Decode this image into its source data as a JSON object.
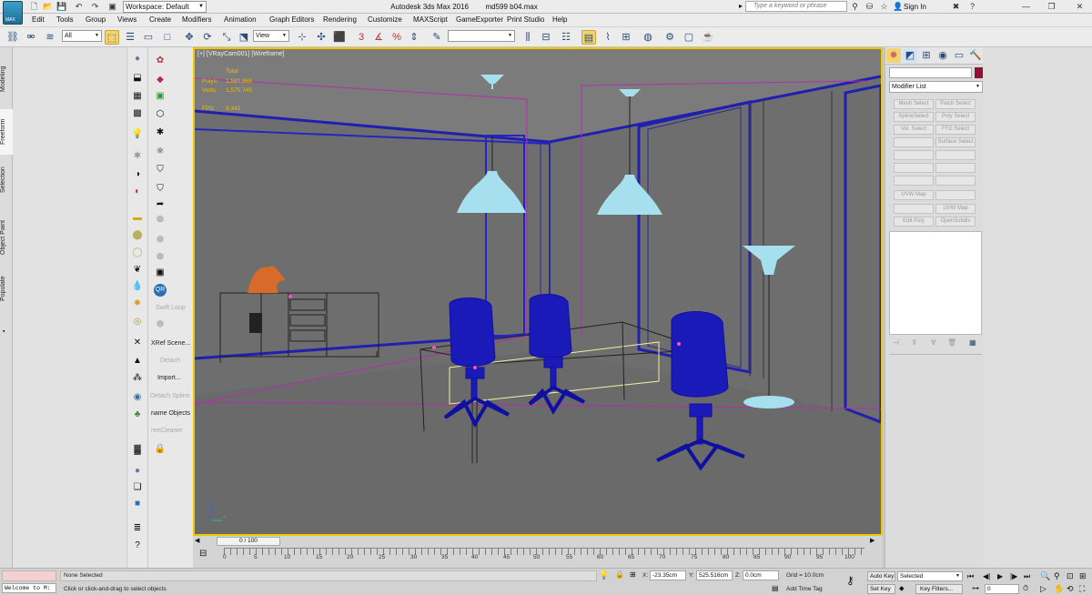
{
  "title_bar": {
    "app_title": "Autodesk 3ds Max 2016",
    "file_name": "md599 b04.max",
    "workspace_label": "Workspace: Default",
    "search_placeholder": "Type a keyword or phrase",
    "sign_in": "Sign In",
    "max_badge": "MAX"
  },
  "menu": [
    "Edit",
    "Tools",
    "Group",
    "Views",
    "Create",
    "Modifiers",
    "Animation",
    "Graph Editors",
    "Rendering",
    "Customize",
    "MAXScript",
    "GameExporter",
    "Print Studio",
    "Help"
  ],
  "toolbar": {
    "selection_filter": "All",
    "reference_coord": "View",
    "named_selection": ""
  },
  "left_tabs": [
    "Modeling",
    "Freeform",
    "Selection",
    "Object Paint",
    "Populate"
  ],
  "ribbon_labels": {
    "swift_loop": "Swift Loop",
    "xref_scene": "XRef Scene...",
    "detach": "Detach",
    "import": "Import...",
    "detach_spline": "Detach Spline",
    "rename_objects": "name Objects",
    "tree_cleaner": "reeCleaner"
  },
  "viewport": {
    "label": "[+] [VRayCam001] [Wireframe]",
    "stats_header": "Total",
    "polys_label": "Polys:",
    "polys_value": "1,580,468",
    "verts_label": "Verts:",
    "verts_value": "1,575,745",
    "fps_label": "FPS:",
    "fps_value": "9.342",
    "axis_x": "x",
    "axis_y": "y",
    "colors": {
      "background": "#6f6f6f",
      "wire_blue": "#1a1ab8",
      "lamp": "#a6e0ef",
      "border_active": "#f0c800",
      "plant": "#d86a2a"
    }
  },
  "command_panel": {
    "modifier_list": "Modifier List",
    "buttons": [
      "Mesh Select",
      "Patch Select",
      "SplineSelect",
      "Poly Select",
      "Vol. Select",
      "FFD Select",
      "",
      "Surface Select",
      "",
      "",
      "",
      "",
      "",
      "",
      "UVW Map",
      "",
      "",
      "UVW Map",
      "Edit Poly",
      "OpenSubdiv"
    ]
  },
  "timeline": {
    "slider": "0 / 100",
    "ticks": [
      "0",
      "5",
      "10",
      "15",
      "20",
      "25",
      "30",
      "35",
      "40",
      "45",
      "50",
      "55",
      "60",
      "65",
      "70",
      "75",
      "80",
      "85",
      "90",
      "95",
      "100"
    ]
  },
  "status": {
    "welcome": "Welcome to M:",
    "none_selected": "None Selected",
    "prompt": "Click or click-and-drag to select objects",
    "x_label": "X:",
    "x_value": "-23.35cm",
    "y_label": "Y:",
    "y_value": "525.516cm",
    "z_label": "Z:",
    "z_value": "0.0cm",
    "grid": "Grid = 10.0cm",
    "add_time_tag": "Add Time Tag",
    "auto_key": "Auto Key",
    "set_key": "Set Key",
    "selected": "Selected",
    "key_filters": "Key Filters...",
    "frame": "0"
  }
}
